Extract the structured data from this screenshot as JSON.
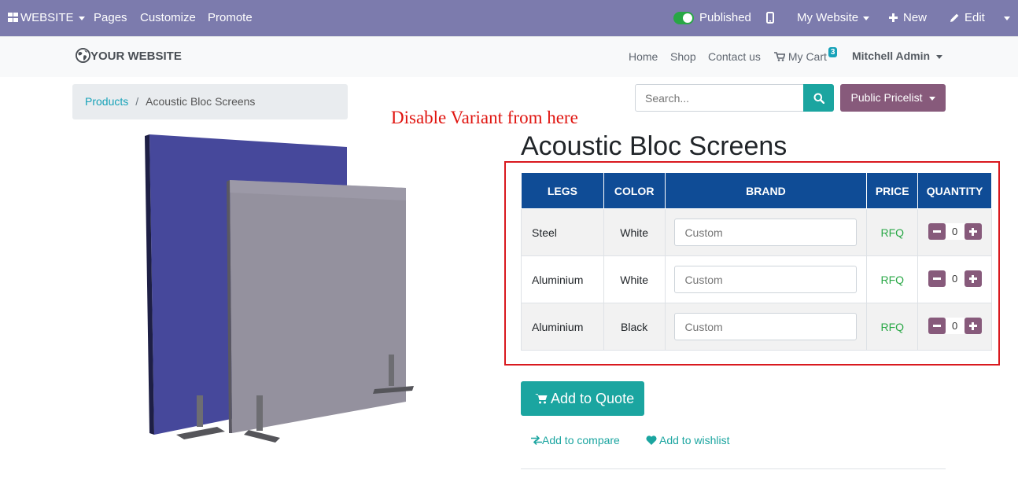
{
  "topbar": {
    "website_label": "WEBSITE",
    "pages_label": "Pages",
    "customize_label": "Customize",
    "promote_label": "Promote",
    "published_label": "Published",
    "my_website_label": "My Website",
    "new_label": "New",
    "edit_label": "Edit"
  },
  "header": {
    "logo_text": "YOUR WEBSITE",
    "nav": [
      "Home",
      "Shop",
      "Contact us",
      "My Cart"
    ],
    "cart_count": "3",
    "user_name": "Mitchell Admin"
  },
  "breadcrumb": {
    "parent": "Products",
    "separator": "/",
    "current": "Acoustic Bloc Screens"
  },
  "search": {
    "placeholder": "Search..."
  },
  "pricelist_label": "Public Pricelist",
  "annotation": "Disable Variant from here",
  "product": {
    "title": "Acoustic Bloc Screens",
    "table_headers": [
      "LEGS",
      "COLOR",
      "BRAND",
      "PRICE",
      "QUANTITY"
    ],
    "rows": [
      {
        "legs": "Steel",
        "color": "White",
        "brand_placeholder": "Custom",
        "price": "RFQ",
        "qty": "0"
      },
      {
        "legs": "Aluminium",
        "color": "White",
        "brand_placeholder": "Custom",
        "price": "RFQ",
        "qty": "0"
      },
      {
        "legs": "Aluminium",
        "color": "Black",
        "brand_placeholder": "Custom",
        "price": "RFQ",
        "qty": "0"
      }
    ],
    "add_to_quote_label": "Add to Quote",
    "add_to_compare_label": "Add to compare",
    "add_to_wishlist_label": "Add to wishlist"
  },
  "colors": {
    "admin_bar": "#7c7bad",
    "accent_teal": "#1ba5a0",
    "pricelist_purple": "#875a7b",
    "table_header_blue": "#0f4c96",
    "annotation_red": "#e0140f",
    "rfq_green": "#28a745"
  }
}
